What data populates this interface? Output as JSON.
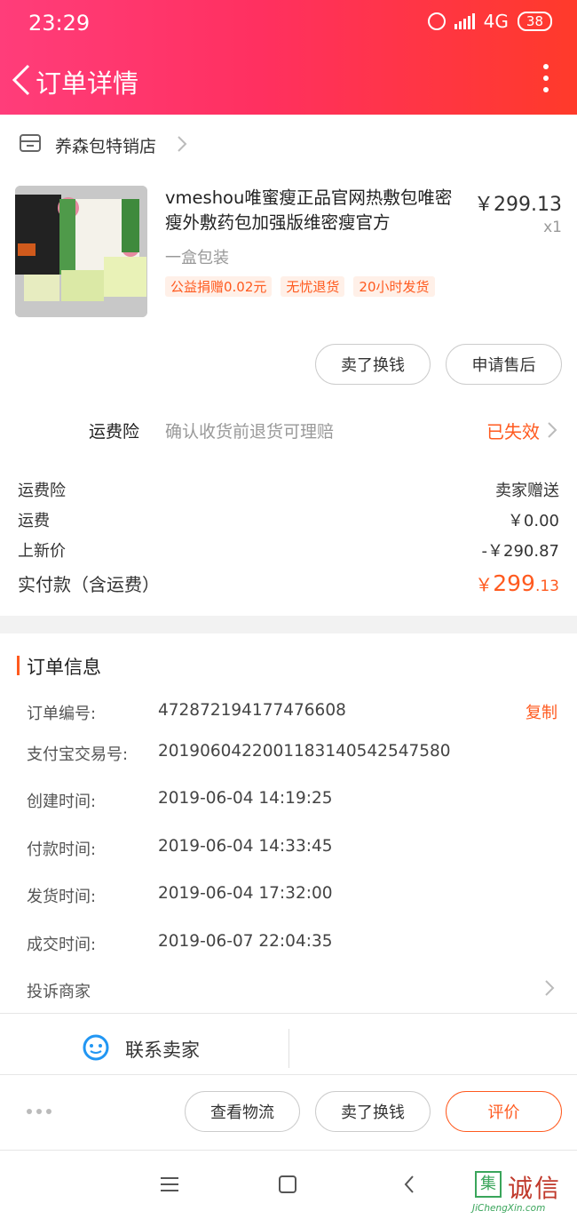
{
  "status_bar": {
    "time": "23:29",
    "network": "4G",
    "battery": "38"
  },
  "navbar": {
    "title": "订单详情"
  },
  "shop": {
    "name": "养森包特销店"
  },
  "product": {
    "name": "vmeshou唯蜜瘦正品官网热敷包唯密瘦外敷药包加强版维密瘦官方",
    "price": "￥299.13",
    "quantity": "x1",
    "spec": "一盒包装",
    "tags": [
      "公益捐赠0.02元",
      "无忧退货",
      "20小时发货"
    ]
  },
  "product_actions": {
    "sell_label": "卖了换钱",
    "after_sale_label": "申请售后"
  },
  "insurance": {
    "label": "运费险",
    "description": "确认收货前退货可理赔",
    "status": "已失效"
  },
  "summary": {
    "rows": [
      {
        "label": "运费险",
        "value": "卖家赠送"
      },
      {
        "label": "运费",
        "value": "￥0.00"
      },
      {
        "label": "上新价",
        "value": "-￥290.87"
      }
    ],
    "total_label": "实付款（含运费）",
    "total_currency": "￥",
    "total_integer": "299",
    "total_decimal": ".13"
  },
  "order_info": {
    "title": "订单信息",
    "copy_label": "复制",
    "rows": [
      {
        "label": "订单编号:",
        "value": "472872194177476608"
      },
      {
        "label": "支付宝交易号:",
        "value": "2019060422001183140542547580"
      },
      {
        "label": "创建时间:",
        "value": "2019-06-04 14:19:25"
      },
      {
        "label": "付款时间:",
        "value": "2019-06-04 14:33:45"
      },
      {
        "label": "发货时间:",
        "value": "2019-06-04 17:32:00"
      },
      {
        "label": "成交时间:",
        "value": "2019-06-07 22:04:35"
      }
    ],
    "complain_label": "投诉商家"
  },
  "contact": {
    "label": "联系卖家"
  },
  "bottom_actions": {
    "logistics_label": "查看物流",
    "sell_label": "卖了换钱",
    "review_label": "评价"
  },
  "watermark": {
    "box_char": "集",
    "brand": "诚信",
    "domain": "JiChengXin.com"
  },
  "colors": {
    "accent": "#ff5a1f",
    "header_start": "#ff3d7a",
    "header_end": "#ff3a2a"
  }
}
